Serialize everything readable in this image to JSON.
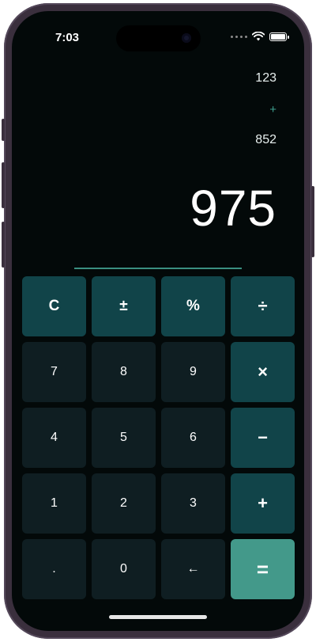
{
  "status_bar": {
    "time": "7:03",
    "icons": [
      "cellular-dots-icon",
      "wifi-icon",
      "battery-icon"
    ]
  },
  "display": {
    "operand_1": "123",
    "operator": "+",
    "operand_2": "852",
    "result": "975"
  },
  "keypad": {
    "rows": [
      [
        {
          "label": "C",
          "kind": "func",
          "name": "clear-button"
        },
        {
          "label": "±",
          "kind": "func",
          "name": "plus-minus-button"
        },
        {
          "label": "%",
          "kind": "func",
          "name": "percent-button"
        },
        {
          "label": "÷",
          "kind": "op",
          "name": "divide-button"
        }
      ],
      [
        {
          "label": "7",
          "kind": "num",
          "name": "digit-7-button"
        },
        {
          "label": "8",
          "kind": "num",
          "name": "digit-8-button"
        },
        {
          "label": "9",
          "kind": "num",
          "name": "digit-9-button"
        },
        {
          "label": "×",
          "kind": "op",
          "name": "multiply-button"
        }
      ],
      [
        {
          "label": "4",
          "kind": "num",
          "name": "digit-4-button"
        },
        {
          "label": "5",
          "kind": "num",
          "name": "digit-5-button"
        },
        {
          "label": "6",
          "kind": "num",
          "name": "digit-6-button"
        },
        {
          "label": "−",
          "kind": "op",
          "name": "subtract-button"
        }
      ],
      [
        {
          "label": "1",
          "kind": "num",
          "name": "digit-1-button"
        },
        {
          "label": "2",
          "kind": "num",
          "name": "digit-2-button"
        },
        {
          "label": "3",
          "kind": "num",
          "name": "digit-3-button"
        },
        {
          "label": "+",
          "kind": "op",
          "name": "add-button"
        }
      ],
      [
        {
          "label": ".",
          "kind": "num",
          "name": "decimal-button"
        },
        {
          "label": "0",
          "kind": "num",
          "name": "digit-0-button"
        },
        {
          "label": "←",
          "kind": "num",
          "name": "backspace-button"
        },
        {
          "label": "=",
          "kind": "equals",
          "name": "equals-button"
        }
      ]
    ]
  },
  "colors": {
    "background": "#030909",
    "number_key": "#0f1e22",
    "function_key": "#114449",
    "equals_key": "#43998a",
    "accent": "#3fa090",
    "frame": "#3a2f3d"
  }
}
